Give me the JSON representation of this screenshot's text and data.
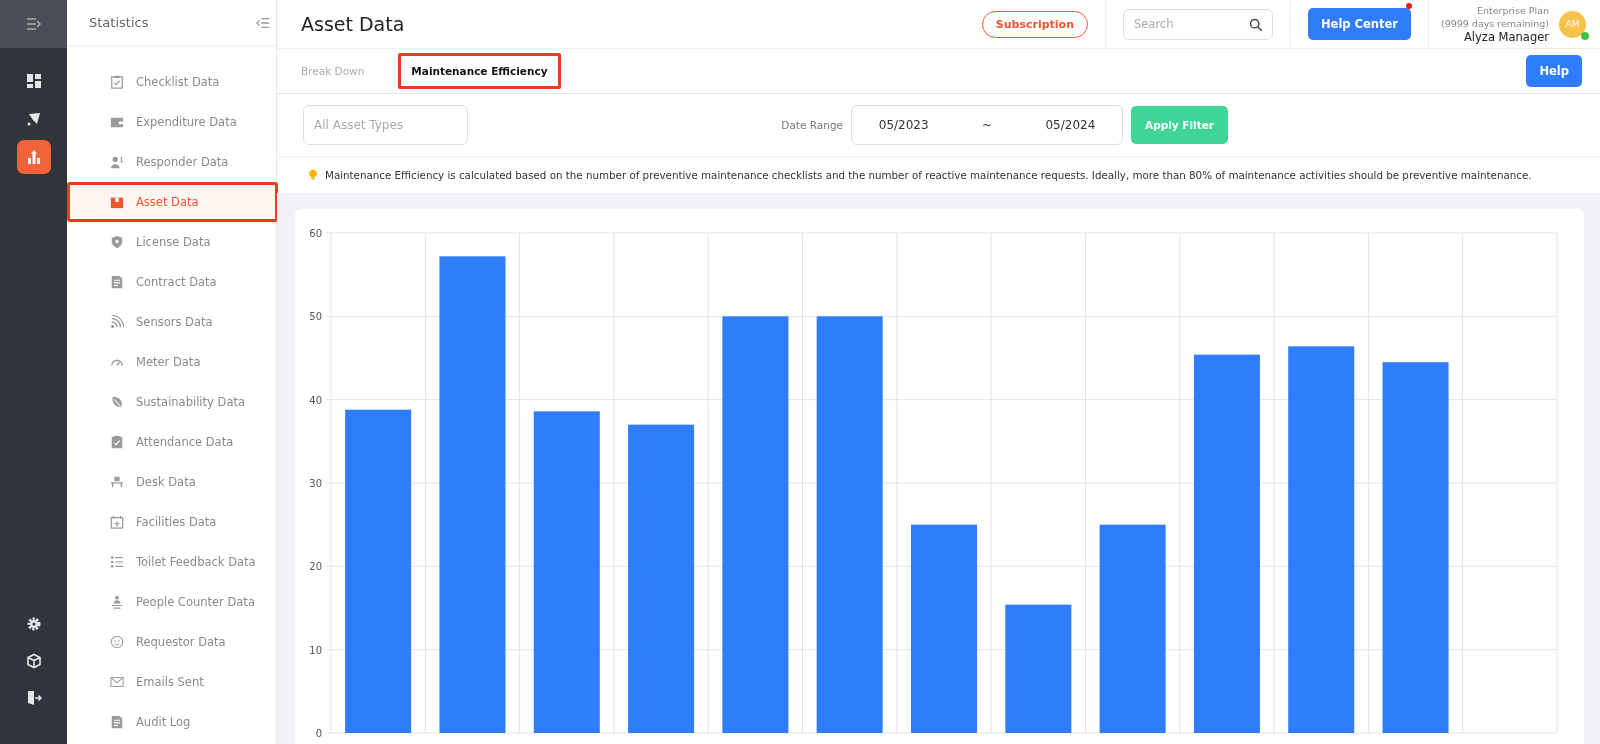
{
  "rail": {
    "top_items": [
      {
        "kind": "dashboard",
        "selected": false
      },
      {
        "kind": "map",
        "selected": false
      },
      {
        "kind": "stats",
        "selected": true
      }
    ],
    "bottom_items": [
      {
        "kind": "settings"
      },
      {
        "kind": "cube"
      },
      {
        "kind": "exit"
      }
    ]
  },
  "sidebar": {
    "title": "Statistics",
    "items": [
      {
        "label": "Checklist Data",
        "kind": "checklist",
        "selected": false
      },
      {
        "label": "Expenditure Data",
        "kind": "wallet",
        "selected": false
      },
      {
        "label": "Responder Data",
        "kind": "person",
        "selected": false
      },
      {
        "label": "Asset Data",
        "kind": "box",
        "selected": true
      },
      {
        "label": "License Data",
        "kind": "shield",
        "selected": false
      },
      {
        "label": "Contract Data",
        "kind": "doc",
        "selected": false
      },
      {
        "label": "Sensors Data",
        "kind": "signal",
        "selected": false
      },
      {
        "label": "Meter Data",
        "kind": "gauge",
        "selected": false
      },
      {
        "label": "Sustainability Data",
        "kind": "leaf",
        "selected": false
      },
      {
        "label": "Attendance Data",
        "kind": "clipboard",
        "selected": false
      },
      {
        "label": "Desk Data",
        "kind": "desk",
        "selected": false
      },
      {
        "label": "Facilities Data",
        "kind": "calendar",
        "selected": false
      },
      {
        "label": "Toilet Feedback Data",
        "kind": "list",
        "selected": false
      },
      {
        "label": "People Counter Data",
        "kind": "people",
        "selected": false
      },
      {
        "label": "Requestor Data",
        "kind": "smile",
        "selected": false
      },
      {
        "label": "Emails Sent",
        "kind": "mail",
        "selected": false
      },
      {
        "label": "Audit Log",
        "kind": "doc",
        "selected": false
      }
    ]
  },
  "header": {
    "title": "Asset Data",
    "subscription": "Subscription",
    "search": {
      "placeholder": "Search"
    },
    "help_center": "Help Center",
    "plan": "Enterprise Plan",
    "remaining": "(9999 days remaining)",
    "user": "Alyza Manager",
    "avatar": "AM"
  },
  "tabs": [
    {
      "label": "Break Down",
      "selected": false
    },
    {
      "label": "Maintenance Efficiency",
      "selected": true
    }
  ],
  "help_button": "Help",
  "filters": {
    "asset_type": {
      "placeholder": "All Asset Types"
    },
    "date_range_label": "Date Range",
    "from": "05/2023",
    "separator": "~",
    "to": "05/2024",
    "apply": "Apply Filter"
  },
  "note": "Maintenance Efficiency is calculated based on the number of preventive maintenance checklists and the number of reactive maintenance requests. Ideally, more than 80% of maintenance activities should be preventive maintenance.",
  "chart": {
    "chart_data": {
      "type": "bar",
      "grid": true,
      "ylim": [
        0,
        60
      ],
      "yticks": [
        0,
        10,
        20,
        30,
        40,
        50,
        60
      ],
      "series": [
        {
          "color": "#2f7dfb",
          "values": [
            38.8,
            57.2,
            38.6,
            37,
            50,
            50,
            25,
            15.4,
            25,
            45.4,
            46.4,
            44.5,
            null
          ]
        }
      ]
    }
  }
}
